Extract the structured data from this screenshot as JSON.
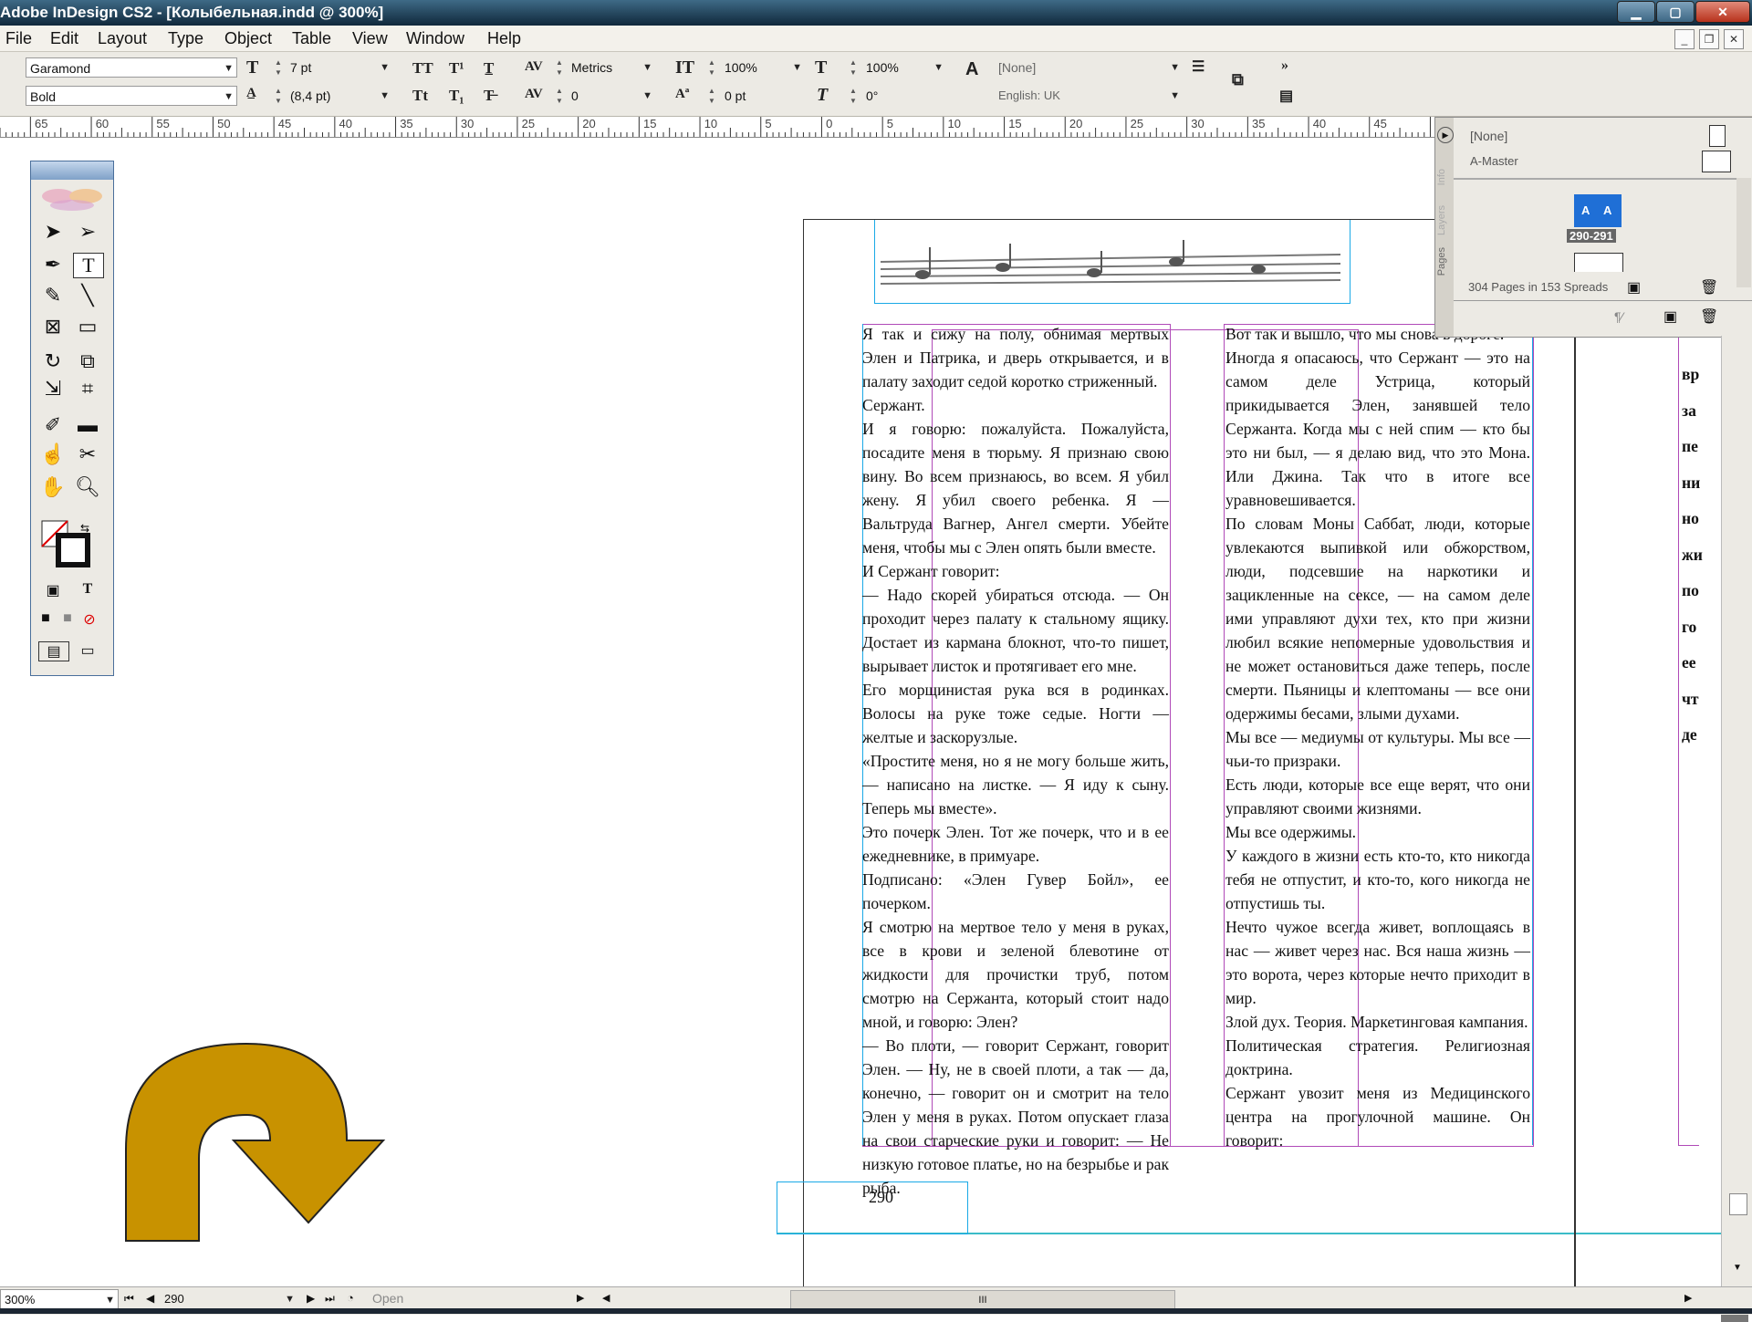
{
  "window": {
    "title": "Adobe InDesign CS2 - [Колыбельная.indd @ 300%]"
  },
  "menu": [
    "File",
    "Edit",
    "Layout",
    "Type",
    "Object",
    "Table",
    "View",
    "Window",
    "Help"
  ],
  "control": {
    "font_family": "Garamond",
    "font_style": "Bold",
    "font_size": "7 pt",
    "leading": "(8,4 pt)",
    "kerning": "Metrics",
    "tracking": "0",
    "vscale": "100%",
    "hscale": "100%",
    "baseline": "0 pt",
    "skew": "0°",
    "char_style": "[None]",
    "language": "English: UK",
    "more": "»"
  },
  "ruler": [
    "65",
    "60",
    "55",
    "50",
    "45",
    "40",
    "35",
    "30",
    "25",
    "20",
    "15",
    "10",
    "5",
    "0",
    "5",
    "10",
    "15",
    "20",
    "25",
    "30",
    "35",
    "40",
    "45",
    "50"
  ],
  "pages_panel": {
    "tabs": [
      "Info",
      "Layers",
      "Pages"
    ],
    "none": "[None]",
    "master": "A-Master",
    "spread_letters": [
      "A",
      "A"
    ],
    "spread_label": "290-291",
    "count": "304 Pages in 153 Spreads"
  },
  "document": {
    "page_number": "290",
    "col1": [
      "Я так и сижу на полу, обнимая мертвых Элен и Патрика, и дверь открывается, и в палату заходит седой коротко стриженный.",
      "Сержант.",
      "И я говорю: пожалуйста. Пожалуйста, посадите меня в тюрьму. Я признаю свою вину. Во всем признаюсь, во всем. Я убил жену. Я убил своего ребенка. Я — Вальтруда Вагнер, Ангел смерти. Убейте меня, чтобы мы с Элен опять были вместе.",
      "И Сержант говорит:",
      "— Надо скорей убираться отсюда. — Он проходит через палату к стальному ящику. Достает из кармана блокнот, что-то пишет, вырывает листок и протягивает его мне.",
      "Его морщинистая рука вся в родинках. Волосы на руке тоже седые. Ногти — желтые и заскорузлые.",
      "«Простите меня, но я не могу больше жить, — написано на листке. — Я иду к сыну. Теперь мы вместе».",
      "Это почерк Элен. Тот же почерк, что и в ее ежедневнике, в примуаре.",
      "Подписано: «Элен Гувер Бойл», ее почерком.",
      "Я смотрю на мертвое тело у меня в руках, все в крови и зеленой блевотине от жидкости для прочистки труб, потом смотрю на Сержанта, который стоит надо мной, и говорю: Элен?",
      "— Во плоти, — говорит Сержант, говорит Элен. — Ну, не в своей плоти, а так — да, конечно, — говорит он и смотрит на тело Элен у меня в руках. Потом опускает глаза на свои старческие руки и говорит: — Не низкую готовое платье, но на безрыбье и рак рыба."
    ],
    "col2": [
      "Вот так и вышло, что мы снова в дороге.",
      "Иногда я опасаюсь, что Сержант — это на самом деле Устрица, который прикидывается Элен, занявшей тело Сержанта. Когда мы с ней спим — кто бы это ни был, — я делаю вид, что это Мона. Или Джина. Так что в итоге все уравновешивается.",
      "По словам Моны Саббат, люди, которые увлекаются выпивкой или обжорством, люди, подсевшие на наркотики и зацикленные на сексе, — на самом деле ими управляют духи тех, кто при жизни любил всякие непомерные удовольствия и не может остановиться даже теперь, после смерти. Пьяницы и клептоманы — все они одержимы бесами, злыми духами.",
      "Мы все — медиумы от культуры. Мы все — чьи-то призраки.",
      "Есть люди, которые все еще верят, что они управляют своими жизнями.",
      "Мы все одержимы.",
      "У каждого в жизни есть кто-то, кто никогда тебя не отпустит, и кто-то, кого никогда не отпустишь ты.",
      "Нечто чужое всегда живет, воплощаясь в нас — живет через нас. Вся наша жизнь — это ворота, через которые нечто приходит в мир.",
      "Злой дух. Теория. Маркетинговая кампания.",
      "Политическая стратегия. Религиозная доктрина.",
      "Сержант увозит меня из Медицинского центра на прогулочной машине. Он говорит:"
    ],
    "col3_letters": [
      "вр",
      "за",
      "пе",
      "ни",
      "но",
      "жи",
      "по",
      "го",
      "ее",
      "чт",
      "де"
    ]
  },
  "status": {
    "zoom": "300%",
    "page": "290",
    "open": "Open",
    "scroll_mid": "III"
  },
  "colors": {
    "accent": "#c89200",
    "frame": "#b04ab8",
    "margin": "#3bbcc8",
    "guide": "#1aa9e6"
  }
}
